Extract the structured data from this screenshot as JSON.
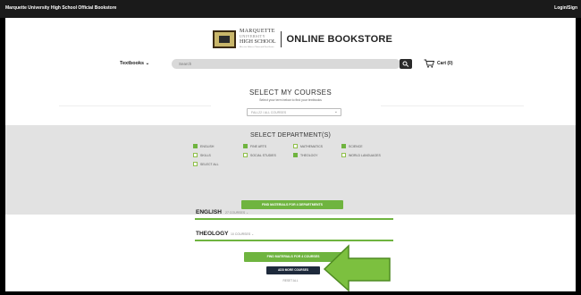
{
  "topbar": {
    "site_name": "Marquette University High School Official Bookstore",
    "login_label": "Login/Sign"
  },
  "header": {
    "school_line1": "MARQUETTE",
    "school_line2": "UNIVERSITY",
    "school_line3": "HIGH SCHOOL",
    "school_tagline": "Men for Others. Christ and Excellence.",
    "store_title": "ONLINE BOOKSTORE"
  },
  "nav": {
    "textbooks_label": "Textbooks",
    "search_placeholder": "Search",
    "cart_label": "Cart (0)"
  },
  "courses": {
    "title": "SELECT MY COURSES",
    "subtitle": "Select your term below to find your textbooks",
    "term_placeholder": "FALL22 / ALL COURSES"
  },
  "departments": {
    "title": "SELECT DEPARTMENT(S)",
    "items": [
      {
        "label": "ENGLISH",
        "checked": true
      },
      {
        "label": "FINE ARTS",
        "checked": true
      },
      {
        "label": "MATHEMATICS",
        "checked": false
      },
      {
        "label": "SCIENCE",
        "checked": true
      },
      {
        "label": "SKILLS",
        "checked": false
      },
      {
        "label": "SOCIAL STUDIES",
        "checked": false
      },
      {
        "label": "THEOLOGY",
        "checked": true
      },
      {
        "label": "WORLD LANGUAGES",
        "checked": false
      },
      {
        "label": "SELECT ALL",
        "checked": false
      }
    ],
    "find_button": "FIND MATERIALS FOR 4 DEPARTMENTS"
  },
  "subjects": [
    {
      "name": "ENGLISH",
      "count": "27 COURSES"
    },
    {
      "name": "THEOLOGY",
      "count": "10 COURSES"
    }
  ],
  "actions": {
    "find_courses": "FIND MATERIALS FOR 4 COURSES",
    "add_more": "ADD MORE COURSES",
    "reset": "RESET ALL"
  },
  "colors": {
    "accent_green": "#6fb43f",
    "arrow_green": "#7cc03f",
    "navy": "#1e2a3c"
  }
}
